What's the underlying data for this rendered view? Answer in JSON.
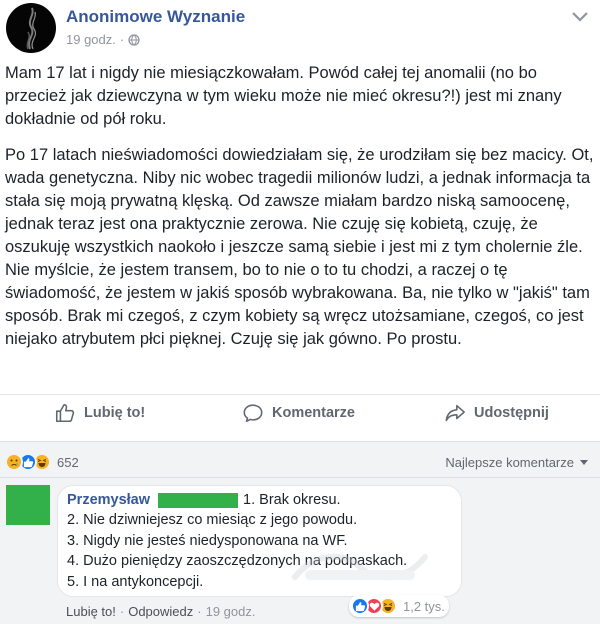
{
  "post": {
    "author": "Anonimowe Wyznanie",
    "time": "19 godz.",
    "audience_icon": "globe-icon",
    "paragraphs": [
      "Mam 17 lat i nigdy nie miesiączkowałam. Powód całej tej anomalii (no bo przecież jak dziewczyna w tym wieku może nie mieć okresu?!) jest mi znany dokładnie od pół roku.",
      "Po 17 latach nieświadomości dowiedziałam się, że urodziłam się bez macicy. Ot, wada genetyczna. Niby nic wobec tragedii milionów ludzi, a jednak informacja ta stała się moją prywatną klęską. Od zawsze miałam bardzo niską samoocenę, jednak teraz jest ona praktycznie zerowa. Nie czuję się kobietą, czuję, że oszukuję wszystkich naokoło i jeszcze samą siebie i jest mi z tym cholernie źle. Nie myślcie, że jestem transem, bo to nie o to tu chodzi, a raczej o tę świadomość, że jestem w jakiś sposób wybrakowana. Ba, nie tylko w \"jakiś\" tam sposób. Brak mi czegoś, z czym kobiety są wręcz utożsamiane, czegoś, co jest niejako atrybutem płci pięknej. Czuję się jak gówno. Po prostu."
    ]
  },
  "actions": {
    "like": "Lubię to!",
    "comment": "Komentarze",
    "share": "Udostępnij"
  },
  "reactions": {
    "icons": [
      "sad-icon",
      "like-icon",
      "haha-icon"
    ],
    "count": "652"
  },
  "sort_label": "Najlepsze komentarze",
  "comment": {
    "author": "Przemysław",
    "text_first": "1. Brak okresu.",
    "lines": [
      "2. Nie dziwniejesz co miesiąc z jego powodu.",
      "3. Nigdy nie jesteś niedysponowana na WF.",
      "4. Dużo pieniędzy zaoszczędzonych na podpaskach.",
      "5. I na antykoncepcji."
    ],
    "like": "Lubię to!",
    "reply": "Odpowiedz",
    "separator": "·",
    "time": "19 godz.",
    "reaction_icons": [
      "like-icon",
      "love-icon",
      "haha-icon"
    ],
    "reaction_count": "1,2 tys."
  },
  "colors": {
    "link_blue": "#365899",
    "redaction_green": "#32b04a",
    "muted_gray": "#90949c",
    "like_blue": "#1877f2",
    "love_red": "#f33e58",
    "emoji_yellow": "#f7b125"
  }
}
